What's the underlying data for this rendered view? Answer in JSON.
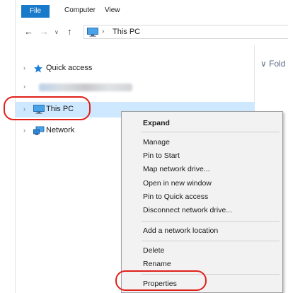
{
  "ribbon": {
    "tabs": [
      {
        "label": "File"
      },
      {
        "label": "Computer"
      },
      {
        "label": "View"
      }
    ]
  },
  "address": {
    "path": "This PC"
  },
  "nav_tree": {
    "items": [
      {
        "label": "Quick access"
      },
      {
        "label": ""
      },
      {
        "label": "This PC"
      },
      {
        "label": "Network"
      }
    ]
  },
  "content": {
    "header_partial": "Fold"
  },
  "context_menu": {
    "items": [
      {
        "label": "Expand"
      },
      {
        "label": "Manage"
      },
      {
        "label": "Pin to Start"
      },
      {
        "label": "Map network drive..."
      },
      {
        "label": "Open in new window"
      },
      {
        "label": "Pin to Quick access"
      },
      {
        "label": "Disconnect network drive..."
      },
      {
        "label": "Add a network location"
      },
      {
        "label": "Delete"
      },
      {
        "label": "Rename"
      },
      {
        "label": "Properties"
      }
    ]
  },
  "colors": {
    "accent": "#1979ca",
    "selection": "#cde8ff",
    "highlight_annotation": "#e0201a"
  }
}
